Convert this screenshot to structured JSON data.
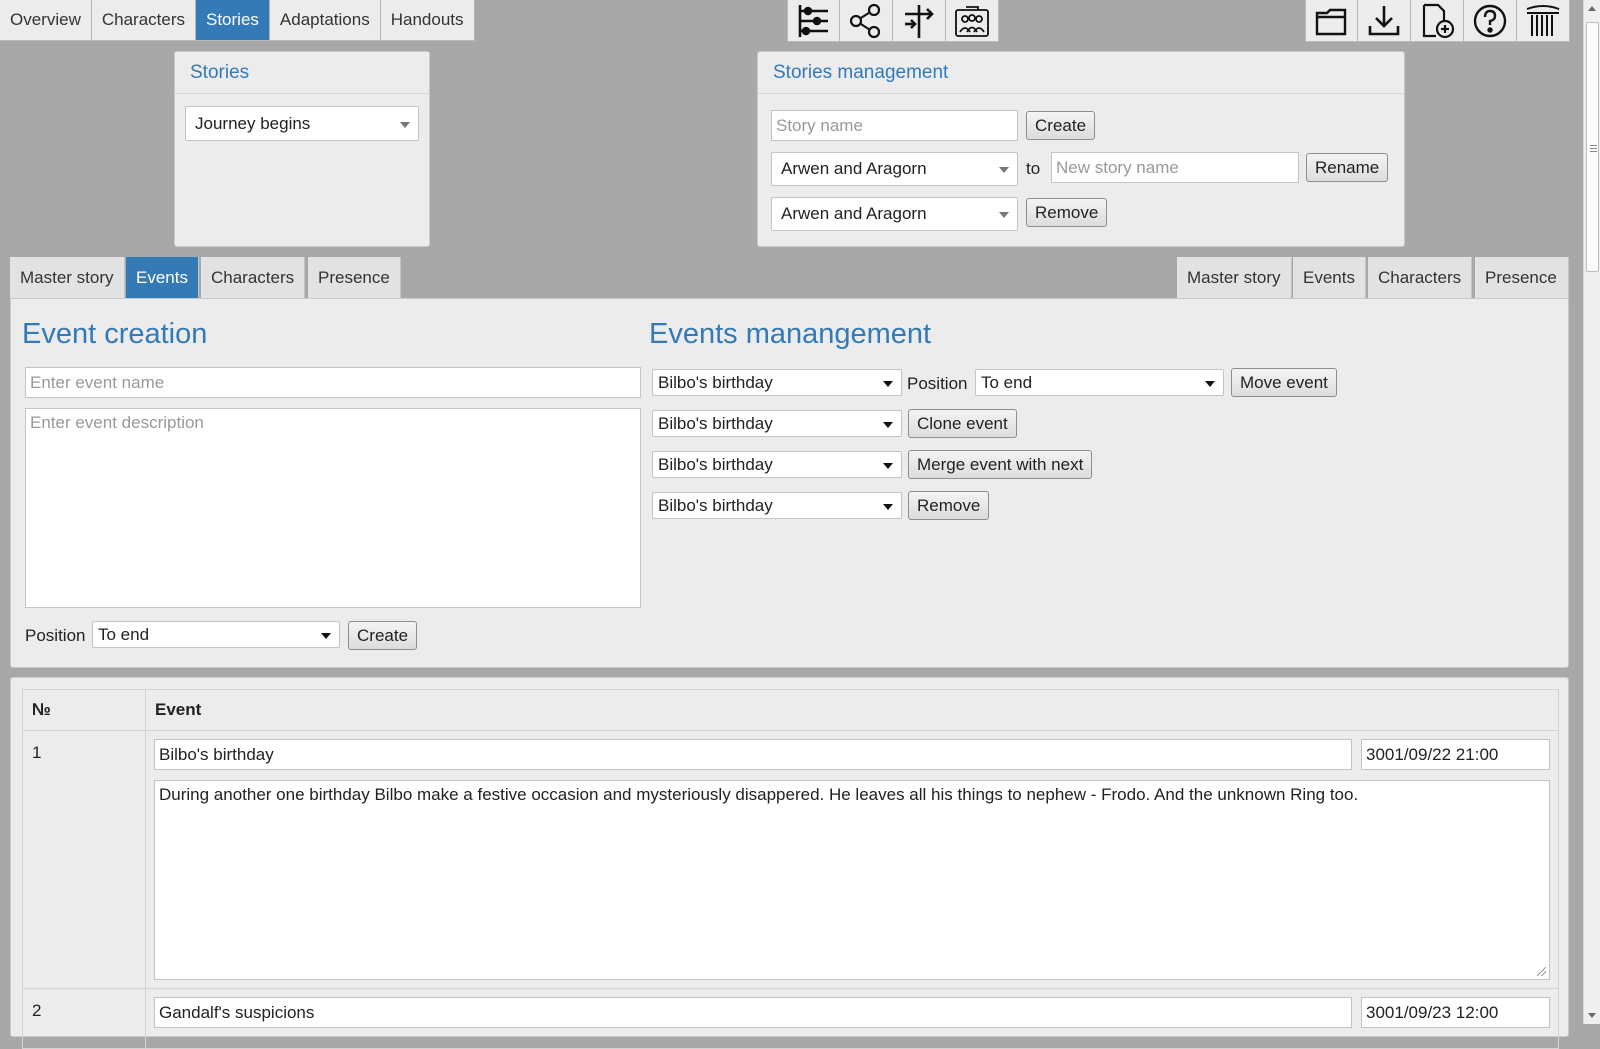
{
  "nav": {
    "tabs": [
      {
        "label": "Overview",
        "active": false
      },
      {
        "label": "Characters",
        "active": false
      },
      {
        "label": "Stories",
        "active": true
      },
      {
        "label": "Adaptations",
        "active": false
      },
      {
        "label": "Handouts",
        "active": false
      }
    ],
    "center_icons": [
      "timeline-icon",
      "share-network-icon",
      "signpost-icon",
      "group-portrait-icon"
    ],
    "right_icons": [
      "folder-icon",
      "download-icon",
      "add-file-icon",
      "help-icon",
      "columns-logo-icon"
    ]
  },
  "stories_panel": {
    "title": "Stories",
    "selected_story": "Journey begins"
  },
  "stories_management": {
    "title": "Stories management",
    "story_name_placeholder": "Story name",
    "create_label": "Create",
    "rename_select": "Arwen and Aragorn",
    "to_label": "to",
    "new_name_placeholder": "New story name",
    "rename_label": "Rename",
    "remove_select": "Arwen and Aragorn",
    "remove_label": "Remove"
  },
  "subtabs_left": [
    "Master story",
    "Events",
    "Characters",
    "Presence"
  ],
  "subtabs_left_active": "Events",
  "subtabs_right": [
    "Master story",
    "Events",
    "Characters",
    "Presence"
  ],
  "event_creation": {
    "title": "Event creation",
    "name_placeholder": "Enter event name",
    "description_placeholder": "Enter event description",
    "position_label": "Position",
    "position_value": "To end",
    "create_label": "Create"
  },
  "events_management": {
    "title": "Events manangement",
    "move_select": "Bilbo's birthday",
    "position_label": "Position",
    "position_value": "To end",
    "move_label": "Move event",
    "clone_select": "Bilbo's birthday",
    "clone_label": "Clone event",
    "merge_select": "Bilbo's birthday",
    "merge_label": "Merge event with next",
    "remove_select": "Bilbo's birthday",
    "remove_label": "Remove"
  },
  "events_table": {
    "col_num": "№",
    "col_event": "Event",
    "rows": [
      {
        "num": "1",
        "name": "Bilbo's birthday",
        "time": "3001/09/22 21:00",
        "description": "During another one birthday Bilbo make a festive occasion and mysteriously disappered. He leaves all his things to nephew - Frodo. And the unknown Ring too."
      },
      {
        "num": "2",
        "name": "Gandalf's suspicions",
        "time": "3001/09/23 12:00",
        "description": ""
      }
    ]
  },
  "colors": {
    "accent": "#337ab7",
    "background": "#a8a8a8",
    "panel": "#ececec"
  }
}
